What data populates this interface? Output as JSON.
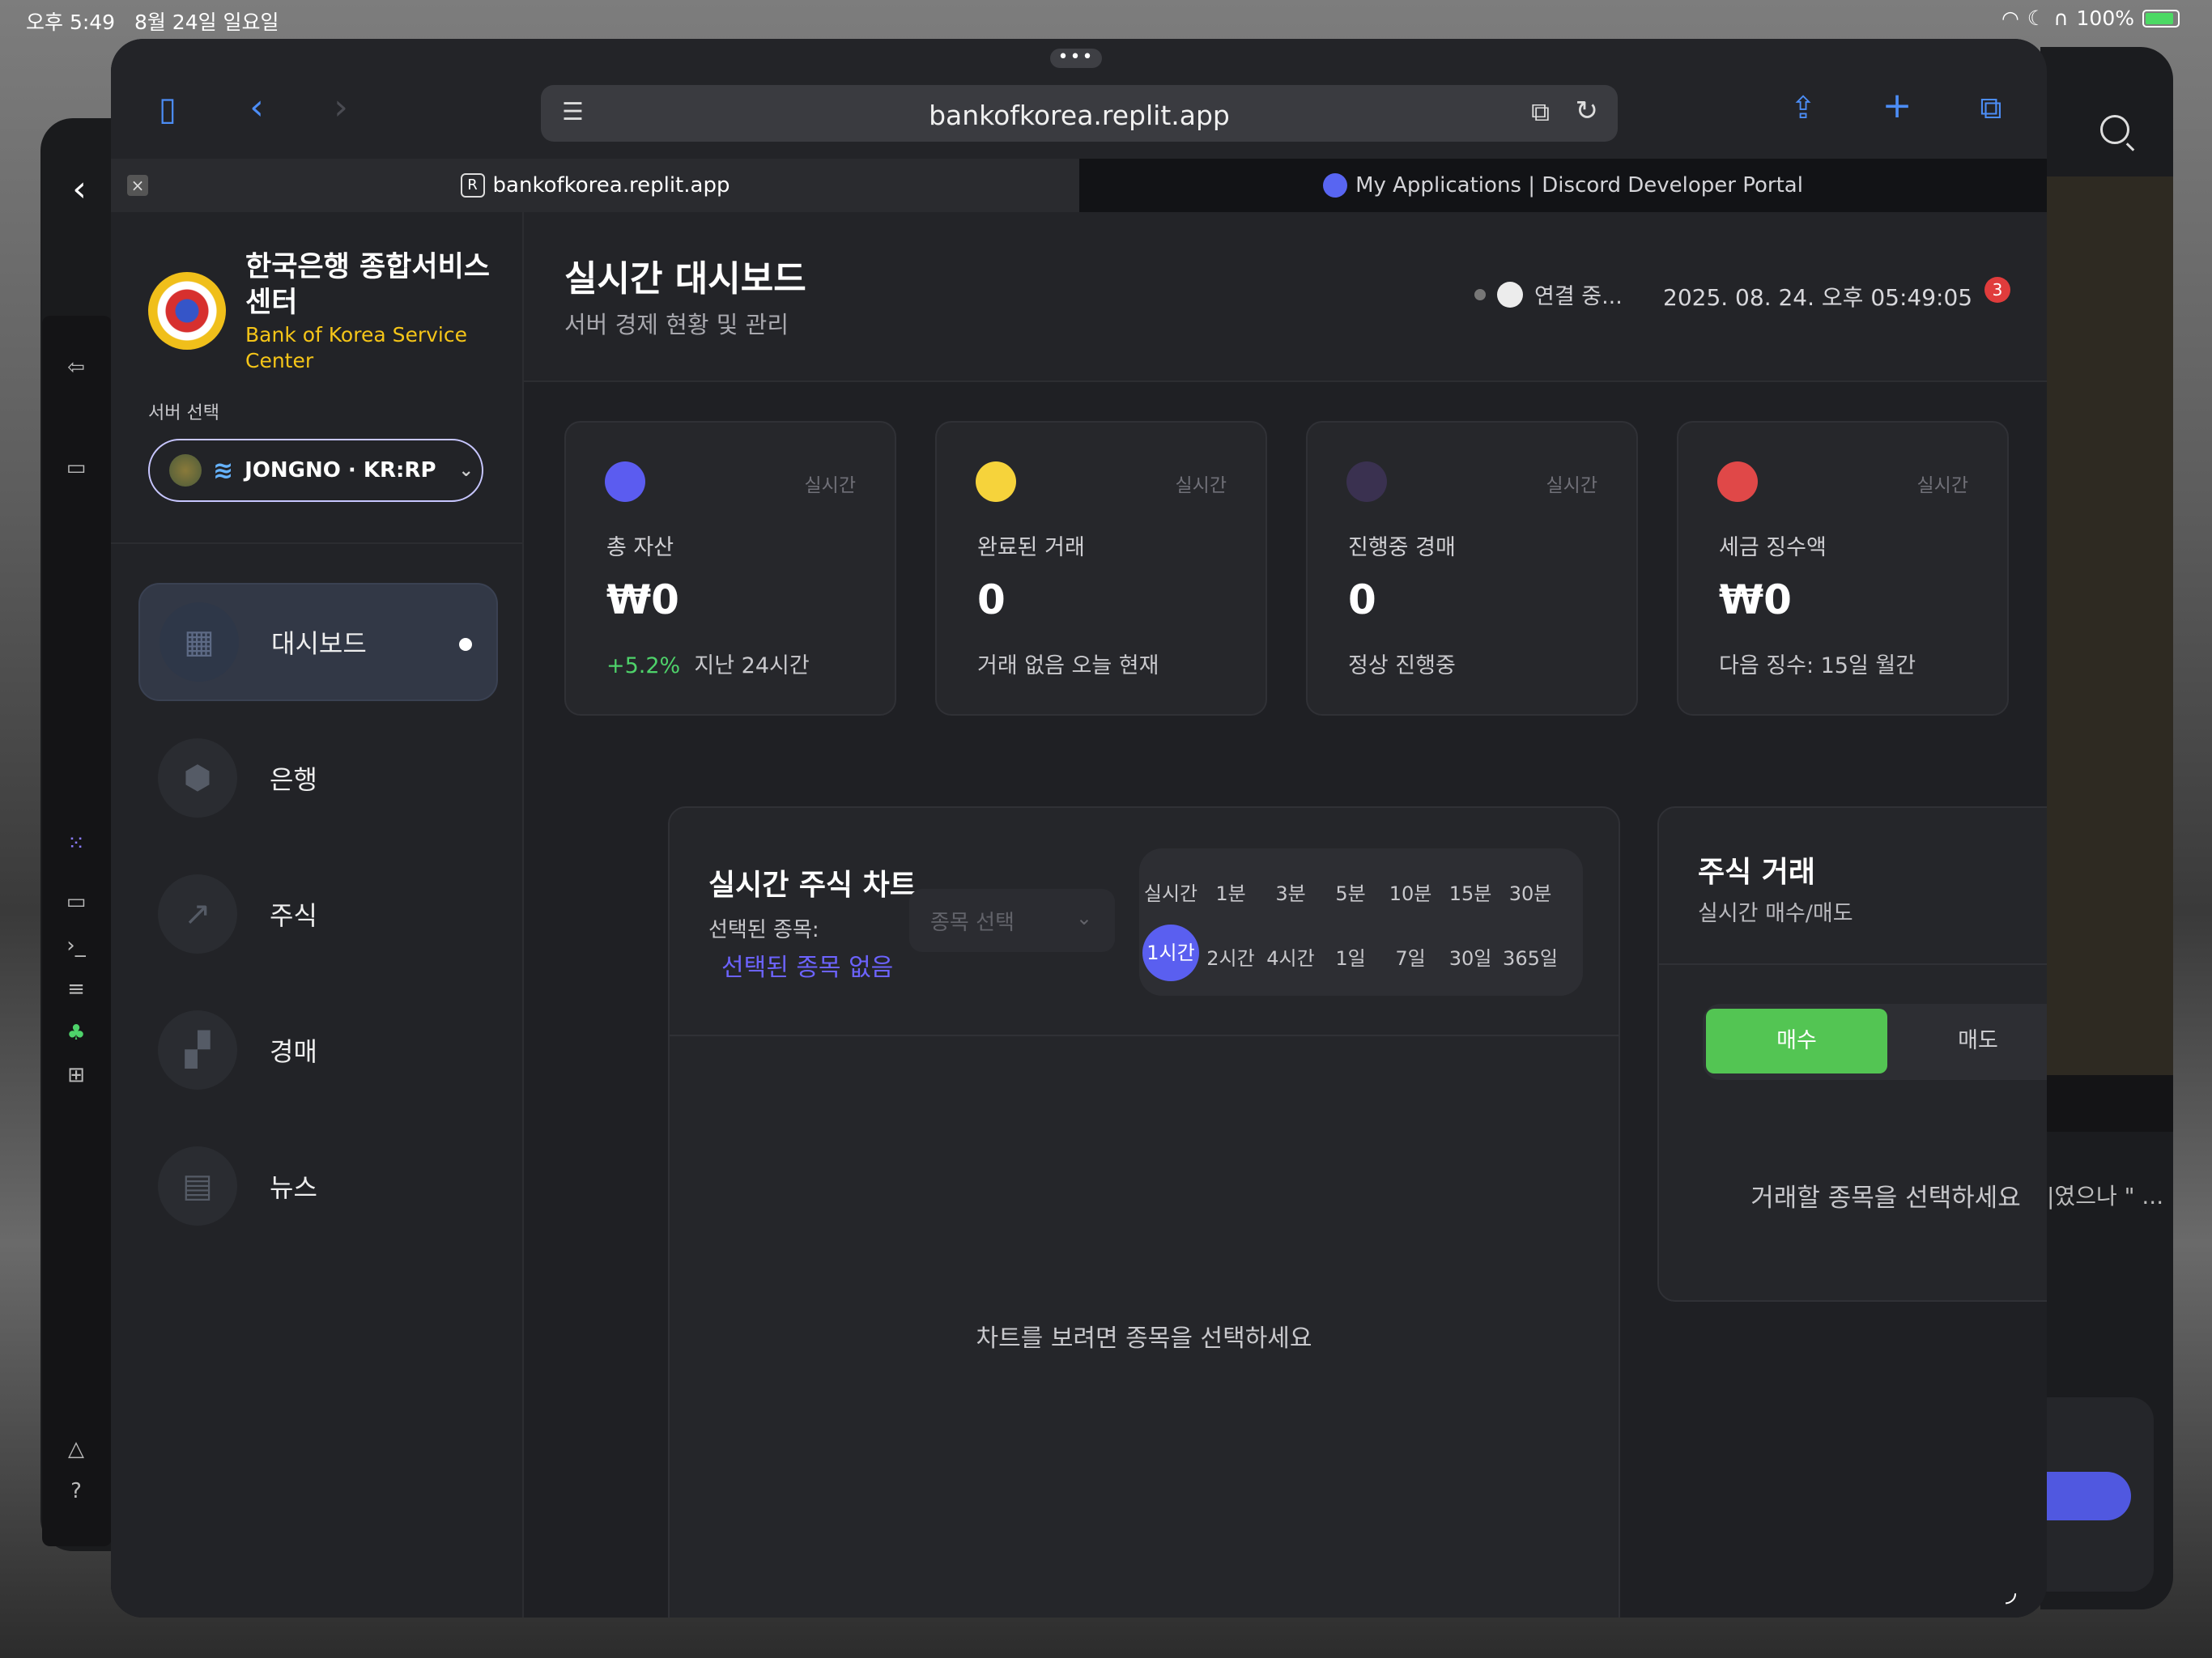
{
  "status_bar": {
    "time": "오후 5:49",
    "date": "8월 24일 일요일",
    "battery": "100%"
  },
  "browser": {
    "url": "bankofkorea.replit.app",
    "tabs": [
      {
        "label": "bankofkorea.replit.app",
        "favicon": "R"
      },
      {
        "label": "My Applications | Discord Developer Portal"
      }
    ]
  },
  "background_window": {
    "snippet": "|였으나 \" ..."
  },
  "sidebar": {
    "brand_ko": "한국은행 종합서비스 센터",
    "brand_en": "Bank of Korea Service Center",
    "server_label": "서버 선택",
    "server_value": "JONGNO · KR:RP",
    "items": [
      {
        "label": "대시보드",
        "icon": "dashboard-icon",
        "active": true
      },
      {
        "label": "은행",
        "icon": "bank-icon"
      },
      {
        "label": "주식",
        "icon": "trend-icon"
      },
      {
        "label": "경매",
        "icon": "auction-icon"
      },
      {
        "label": "뉴스",
        "icon": "news-icon"
      }
    ]
  },
  "header": {
    "title": "실시간 대시보드",
    "subtitle": "서버 경제 현황 및 관리",
    "connection": "연결 중...",
    "datetime": "2025. 08. 24. 오후 05:49:05",
    "notifications": "3"
  },
  "cards": [
    {
      "tag": "실시간",
      "label": "총 자산",
      "value": "₩0",
      "change": "+5.2%",
      "note": "지난 24시간",
      "color": "#5b5cf0"
    },
    {
      "tag": "실시간",
      "label": "완료된 거래",
      "value": "0",
      "note": "거래 없음 오늘 현재",
      "color": "#f6d33b"
    },
    {
      "tag": "실시간",
      "label": "진행중 경매",
      "value": "0",
      "note": "정상 진행중",
      "color": "#3a3150"
    },
    {
      "tag": "실시간",
      "label": "세금 징수액",
      "value": "₩0",
      "note": "다음 징수: 15일 월간",
      "color": "#e04848"
    }
  ],
  "chart_panel": {
    "title": "실시간 주식 차트",
    "selected_label": "선택된 종목:",
    "selected_value": "선택된 종목 없음",
    "dropdown": "종목 선택",
    "timeframes_row1": [
      "실시간",
      "1분",
      "3분",
      "5분",
      "10분",
      "15분",
      "30분"
    ],
    "timeframes_row2": [
      "1시간",
      "2시간",
      "4시간",
      "1일",
      "7일",
      "30일",
      "365일"
    ],
    "active_timeframe": "1시간",
    "empty": "차트를 보려면 종목을 선택하세요"
  },
  "trade_panel": {
    "title": "주식 거래",
    "subtitle": "실시간 매수/매도",
    "buy": "매수",
    "sell": "매도",
    "empty": "거래할 종목을 선택하세요"
  }
}
